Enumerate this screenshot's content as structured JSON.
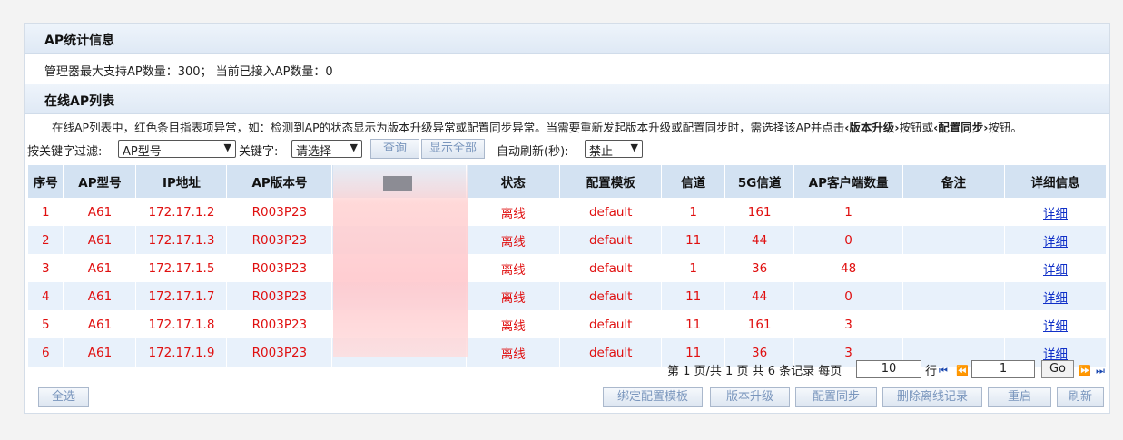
{
  "stats_section": {
    "title": "AP统计信息",
    "info": "管理器最大支持AP数量：300；  当前已接入AP数量：0"
  },
  "online_section": {
    "title": "在线AP列表",
    "note_a": "在线AP列表中，红色条目指表项异常，如：检测到AP的状态显示为版本升级异常或配置同步异常。当需要重新发起版本升级或配置同步时，需选择该AP并点击",
    "note_b": "‹版本升级›",
    "note_c": "按钮或",
    "note_d": "‹配置同步›",
    "note_e": "按钮。"
  },
  "filter": {
    "label": "按关键字过滤:",
    "field_value": "AP型号",
    "keyword_label": "关键字:",
    "keyword_value": "请选择",
    "query_button": "查询",
    "show_all_button": "显示全部",
    "refresh_label": "自动刷新(秒):",
    "refresh_value": "禁止"
  },
  "table": {
    "headers": [
      "序号",
      "AP型号",
      "IP地址",
      "AP版本号",
      "",
      "状态",
      "配置模板",
      "信道",
      "5G信道",
      "AP客户端数量",
      "备注",
      "详细信息"
    ],
    "rows": [
      [
        "1",
        "A61",
        "172.17.1.2",
        "R003P23",
        "",
        "离线",
        "default",
        "1",
        "161",
        "1",
        "",
        "详细"
      ],
      [
        "2",
        "A61",
        "172.17.1.3",
        "R003P23",
        "",
        "离线",
        "default",
        "11",
        "44",
        "0",
        "",
        "详细"
      ],
      [
        "3",
        "A61",
        "172.17.1.5",
        "R003P23",
        "",
        "离线",
        "default",
        "1",
        "36",
        "48",
        "",
        "详细"
      ],
      [
        "4",
        "A61",
        "172.17.1.7",
        "R003P23",
        "",
        "离线",
        "default",
        "11",
        "44",
        "0",
        "",
        "详细"
      ],
      [
        "5",
        "A61",
        "172.17.1.8",
        "R003P23",
        "",
        "离线",
        "default",
        "11",
        "161",
        "3",
        "",
        "详细"
      ],
      [
        "6",
        "A61",
        "172.17.1.9",
        "R003P23",
        "",
        "离线",
        "default",
        "11",
        "36",
        "3",
        "",
        "详细"
      ]
    ]
  },
  "pager": {
    "summary": "第 1 页/共 1 页 共 6 条记录 每页",
    "per_page": "10",
    "rows_label": "行",
    "page": "1",
    "go": "Go"
  },
  "actions": {
    "select_all": "全选",
    "bind_template": "绑定配置模板",
    "upgrade": "版本升级",
    "sync": "配置同步",
    "delete_offline": "删除离线记录",
    "restart": "重启",
    "refresh": "刷新"
  }
}
